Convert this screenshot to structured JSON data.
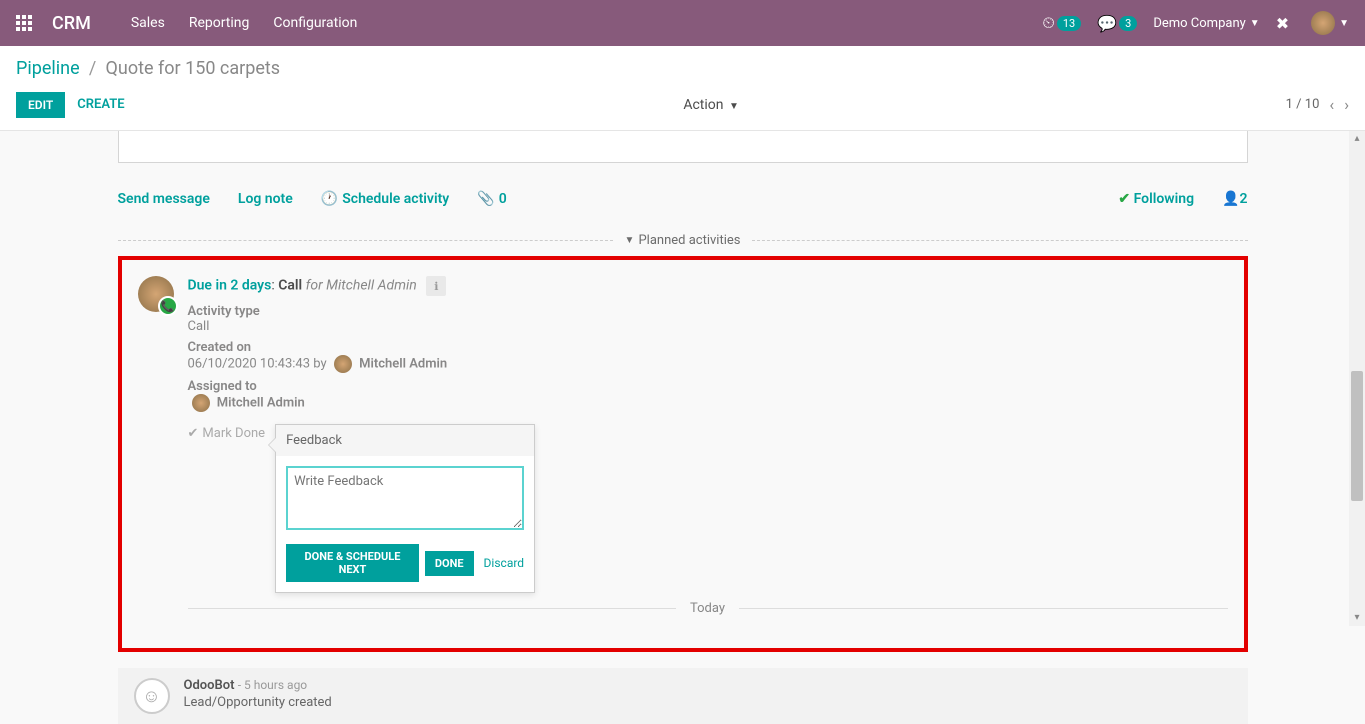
{
  "navbar": {
    "brand": "CRM",
    "menu": [
      "Sales",
      "Reporting",
      "Configuration"
    ],
    "activities_count": "13",
    "messages_count": "3",
    "company": "Demo Company"
  },
  "breadcrumb": {
    "parent": "Pipeline",
    "current": "Quote for 150 carpets"
  },
  "controls": {
    "edit": "EDIT",
    "create": "CREATE",
    "action": "Action",
    "pager": "1 / 10"
  },
  "chatter": {
    "send_message": "Send message",
    "log_note": "Log note",
    "schedule_activity": "Schedule activity",
    "attachments": "0",
    "following": "Following",
    "followers": "2"
  },
  "planned_activities_label": "Planned activities",
  "activity": {
    "due": "Due in 2 days",
    "type_short": "Call",
    "for_prefix": "for",
    "for_user": "Mitchell Admin",
    "labels": {
      "activity_type": "Activity type",
      "created_on": "Created on",
      "assigned_to": "Assigned to"
    },
    "activity_type_value": "Call",
    "created_on_value": "06/10/2020 10:43:43 by",
    "created_by": "Mitchell Admin",
    "assigned_to_value": "Mitchell Admin",
    "mark_done": "Mark Done"
  },
  "popover": {
    "title": "Feedback",
    "placeholder": "Write Feedback",
    "done_schedule": "DONE & SCHEDULE NEXT",
    "done": "DONE",
    "discard": "Discard"
  },
  "today_label": "Today",
  "log": {
    "author": "OdooBot",
    "time": "- 5 hours ago",
    "message": "Lead/Opportunity created"
  }
}
